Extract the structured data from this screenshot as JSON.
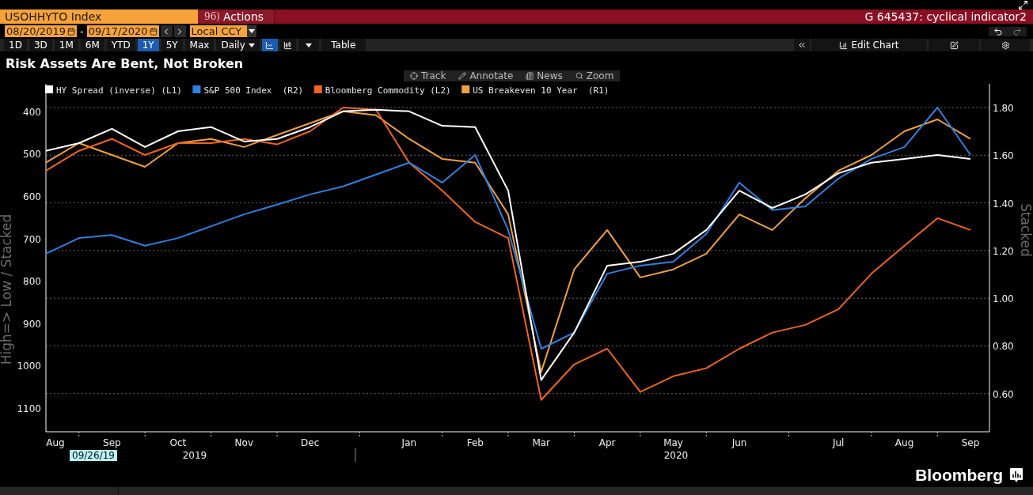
{
  "toolbar": {
    "ticker": "USOHHYTO Index",
    "actions_number": "96)",
    "actions_label": "Actions",
    "chart_name": "G 645437: cyclical indicator2"
  },
  "date_range": {
    "start": "08/20/2019",
    "separator": "-",
    "end": "09/17/2020",
    "currency": "Local CCY"
  },
  "periods": [
    {
      "label": "1D",
      "selected": false
    },
    {
      "label": "3D",
      "selected": false
    },
    {
      "label": "1M",
      "selected": false
    },
    {
      "label": "6M",
      "selected": false
    },
    {
      "label": "YTD",
      "selected": false
    },
    {
      "label": "1Y",
      "selected": true
    },
    {
      "label": "5Y",
      "selected": false
    },
    {
      "label": "Max",
      "selected": false
    }
  ],
  "frequency": "Daily",
  "chart_types": [
    {
      "kind": "line",
      "selected": true
    },
    {
      "kind": "candle",
      "selected": false
    }
  ],
  "table_button": "Table",
  "edit_chart": "Edit Chart",
  "title": "Risk Assets Are Bent, Not Broken",
  "chart_tools": [
    {
      "kind": "track",
      "label": "Track"
    },
    {
      "kind": "annotate",
      "label": "Annotate"
    },
    {
      "kind": "news",
      "label": "News"
    },
    {
      "kind": "zoom",
      "label": "Zoom"
    }
  ],
  "chart": {
    "cursor_date": "09/26/19",
    "years": [
      "2019",
      "2020"
    ],
    "y2label": "Stacked",
    "y2ticks": [
      "1.80",
      "1.60",
      "1.40",
      "1.20",
      "1.00",
      "0.80",
      "0.60"
    ],
    "chart_data": {
      "type": "line",
      "ylabel": "High=> Low / Stacked",
      "categories": [
        "Aug",
        null,
        "Sep",
        null,
        "Oct",
        null,
        "Nov",
        null,
        "Dec",
        null,
        null,
        "Jan",
        null,
        "Feb",
        null,
        "Mar",
        null,
        "Apr",
        null,
        "May",
        null,
        "Jun",
        null,
        null,
        "Jul",
        null,
        "Aug",
        null,
        "Sep"
      ],
      "ylim": [
        1156,
        335
      ],
      "legend": "top-left",
      "yticks": [
        400,
        500,
        600,
        700,
        800,
        900,
        1000,
        1100
      ],
      "series": [
        {
          "name": "HY Spread (inverse) (L1)",
          "color": "#ffffff",
          "values": [
            493,
            475,
            441,
            484,
            447,
            437,
            471,
            465,
            437,
            400,
            396,
            400,
            434,
            437,
            587,
            1034,
            922,
            764,
            755,
            736,
            680,
            587,
            628,
            596,
            546,
            521,
            512,
            503,
            512
          ]
        },
        {
          "name": "S&P 500 Index  (R2)",
          "color": "#2f7fe0",
          "values": [
            736,
            699,
            692,
            717,
            699,
            671,
            643,
            620,
            596,
            577,
            549,
            521,
            568,
            503,
            680,
            960,
            922,
            783,
            764,
            755,
            689,
            568,
            633,
            624,
            559,
            512,
            484,
            391,
            503
          ]
        },
        {
          "name": "Bloomberg Commodity (L2)",
          "color": "#f0641e",
          "values": [
            540,
            493,
            465,
            503,
            475,
            475,
            465,
            478,
            447,
            391,
            396,
            521,
            587,
            661,
            699,
            1081,
            997,
            960,
            1062,
            1025,
            1006,
            960,
            922,
            904,
            867,
            783,
            717,
            652,
            680
          ]
        },
        {
          "name": "US Breakeven 10 Year  (R1)",
          "color": "#f0a040",
          "values": [
            521,
            475,
            503,
            531,
            475,
            465,
            484,
            456,
            428,
            400,
            409,
            465,
            512,
            521,
            643,
            1015,
            773,
            680,
            792,
            773,
            736,
            643,
            680,
            605,
            540,
            503,
            447,
            419,
            465
          ]
        }
      ]
    }
  },
  "footer": {
    "brand": "Bloomberg"
  }
}
